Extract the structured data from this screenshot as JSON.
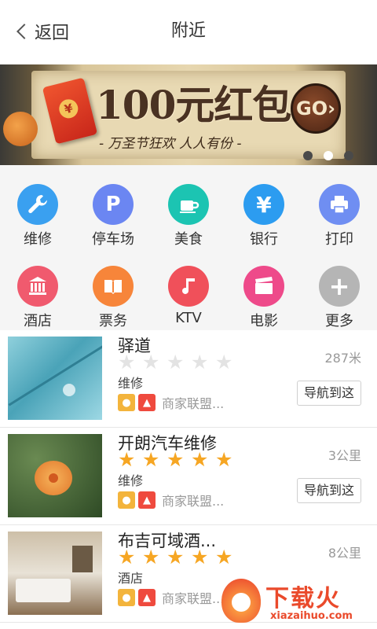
{
  "header": {
    "back_label": "返回",
    "title": "附近"
  },
  "banner": {
    "headline": "100元红包",
    "subtitle": "- 万圣节狂欢 人人有份 -",
    "go_label": "GO›",
    "envelope_symbol": "¥",
    "page_indicator": {
      "total": 3,
      "active": 2
    }
  },
  "categories": [
    {
      "label": "维修",
      "icon": "wrench-icon",
      "color": "#3aa0f0"
    },
    {
      "label": "停车场",
      "icon": "parking-icon",
      "color": "#6b86f2"
    },
    {
      "label": "美食",
      "icon": "coffee-cup-icon",
      "color": "#1cc4b2"
    },
    {
      "label": "银行",
      "icon": "yen-icon",
      "color": "#2c9cf0"
    },
    {
      "label": "打印",
      "icon": "printer-icon",
      "color": "#6f8ef2"
    },
    {
      "label": "酒店",
      "icon": "hotel-icon",
      "color": "#f05a6e"
    },
    {
      "label": "票务",
      "icon": "ticket-book-icon",
      "color": "#f7853a"
    },
    {
      "label": "KTV",
      "icon": "music-note-icon",
      "color": "#f0505a"
    },
    {
      "label": "电影",
      "icon": "clapperboard-icon",
      "color": "#ee4a8a"
    },
    {
      "label": "更多",
      "icon": "plus-icon",
      "color": "#b5b5b5"
    }
  ],
  "places": [
    {
      "name": "驿道",
      "rating": 0,
      "category": "维修",
      "merchant": "商家联盟...",
      "distance": "287米",
      "nav_label": "导航到这",
      "thumb": "feather"
    },
    {
      "name": "开朗汽车维修",
      "rating": 5,
      "category": "维修",
      "merchant": "商家联盟...",
      "distance": "3公里",
      "nav_label": "导航到这",
      "thumb": "flower"
    },
    {
      "name": "布吉可域酒...",
      "rating": 5,
      "category": "酒店",
      "merchant": "商家联盟...",
      "distance": "8公里",
      "nav_label": "",
      "thumb": "hotel-room"
    }
  ],
  "watermark": {
    "text": "下载火",
    "url": "xiazaihuo.com"
  },
  "colors": {
    "star_on": "#f6a623",
    "star_off": "#e3e3e3",
    "badge_bulb": "#f3b43c",
    "badge_fire": "#ef4a3e"
  }
}
